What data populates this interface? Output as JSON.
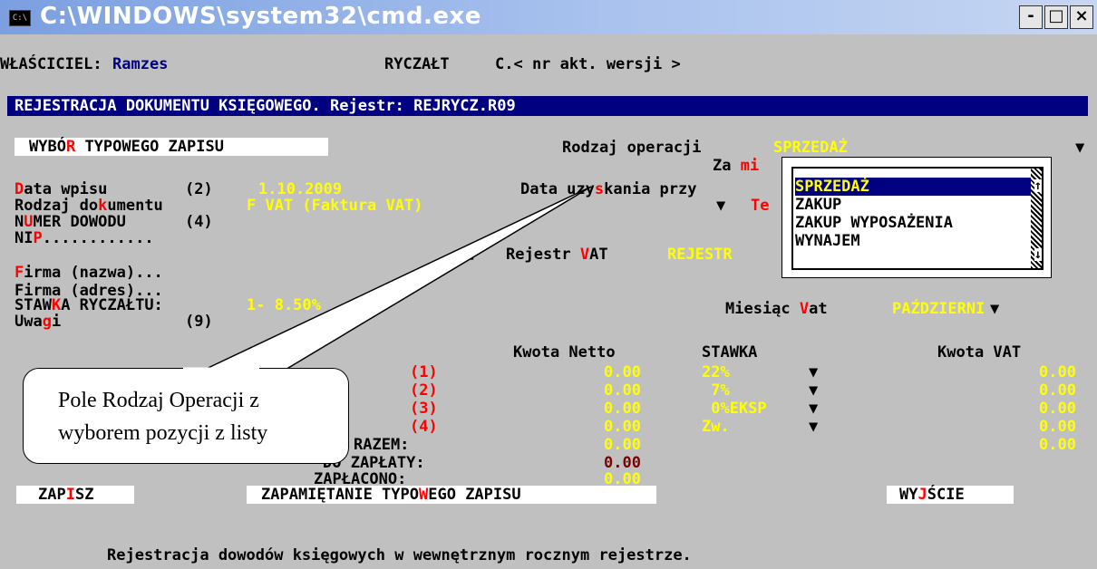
{
  "window": {
    "title": "C:\\WINDOWS\\system32\\cmd.exe",
    "minimize": "-",
    "maximize": "□",
    "close": "×"
  },
  "header": {
    "owner_label": "WŁAŚCICIEL:",
    "owner_value": "Ramzes",
    "mode": "RYCZAŁT",
    "version": "C.< nr akt. wersji >"
  },
  "banner": "REJESTRACJA DOKUMENTU KSIĘGOWEGO. Rejestr: REJRYCZ.R09",
  "typowy": {
    "label_a": "WYBÓ",
    "hotkey": "R",
    "label_b": " TYPOWEGO ZAPISU"
  },
  "operation": {
    "label": "Rodzaj operacji",
    "value": "SPRZEDAŻ",
    "arrow": "▼",
    "za_a": "Za ",
    "za_hot": "mi"
  },
  "fields": {
    "data_wpisu": {
      "hot": "D",
      "rest": "ata wpisu",
      "num": "(2)",
      "value": "1.10.2009"
    },
    "data_uzyskania": {
      "a": "Data uzy",
      "hot": "s",
      "b": "kania przy"
    },
    "rodzaj_dok": {
      "a": "Rodzaj do",
      "hot": "k",
      "b": "umentu",
      "value": "F VAT (Faktura VAT)",
      "arrow": "▼",
      "te_a": "Te",
      "te_hot": ""
    },
    "numer": {
      "a": "N",
      "hot": "U",
      "b": "MER DOWODU",
      "num": "(4)"
    },
    "nip": {
      "a": "NI",
      "hot": "P",
      "b": "............"
    },
    "rejestr": {
      "check": "■",
      "label_a": "Rejestr ",
      "hot": "V",
      "label_b": "AT",
      "value": "REJESTR"
    },
    "firma_nazwa": {
      "hot": "F",
      "rest": "irma (nazwa)..."
    },
    "firma_adres": "Firma (adres)...",
    "stawka": {
      "a": "STAW",
      "hot": "K",
      "b": "A RYCZAŁTU:",
      "value": "1- 8.50%"
    },
    "miesiac": {
      "a": "Miesiąc ",
      "hot": "V",
      "b": "at",
      "value": "PAŹDZIERNI",
      "arrow": "▼"
    },
    "uwagi": {
      "a": "Uwa",
      "hot": "g",
      "b": "i",
      "num": "(9)"
    }
  },
  "dropdown": {
    "items": [
      "SPRZEDAŻ",
      "ZAKUP",
      "ZAKUP WYPOSAŻENIA",
      "WYNAJEM"
    ],
    "selected": 0,
    "scroll_up": "↑",
    "scroll_down": "↓"
  },
  "table": {
    "headers": {
      "netto": "Kwota Netto",
      "stawka": "STAWKA",
      "vat": "Kwota VAT"
    },
    "rows": [
      {
        "idx": "(1)",
        "netto": "0.00",
        "stawka": "22%",
        "arrow": "▼",
        "vat": "0.00"
      },
      {
        "idx": "(2)",
        "netto": "0.00",
        "stawka": " 7%",
        "arrow": "▼",
        "vat": "0.00"
      },
      {
        "idx": "(3)",
        "netto": "0.00",
        "stawka": " 0%EKSP",
        "arrow": "▼",
        "vat": "0.00"
      },
      {
        "idx": "(4)",
        "netto": "0.00",
        "stawka": "Zw.",
        "arrow": "▼",
        "vat": "0.00"
      }
    ],
    "razem_label": "RAZEM:",
    "razem_netto": "0.00",
    "razem_vat": "0.00",
    "do_zaplaty_label": "DO ZAPŁATY:",
    "do_zaplaty": "0.00",
    "zaplacono_label": "ZAPŁACONO:",
    "zaplacono": "0.00"
  },
  "buttons": {
    "zapisz": {
      "a": "ZAP",
      "hot": "I",
      "b": "SZ"
    },
    "zapamietanie": {
      "a": "ZAPAMIĘTANIE TYPO",
      "hot": "W",
      "b": "EGO ZAPISU"
    },
    "wyjscie": {
      "a": "WY",
      "hot": "J",
      "b": "ŚCIE"
    }
  },
  "status_line": "Rejestracja dowodów księgowych w wewnętrznym rocznym rejestrze.",
  "callout": {
    "line1": "Pole Rodzaj Operacji z",
    "line2": "wyborem pozycji z listy"
  },
  "colors": {
    "banner": "#000080",
    "value": "#ffff00",
    "hotkey": "#ff0000",
    "total": "#800000"
  }
}
